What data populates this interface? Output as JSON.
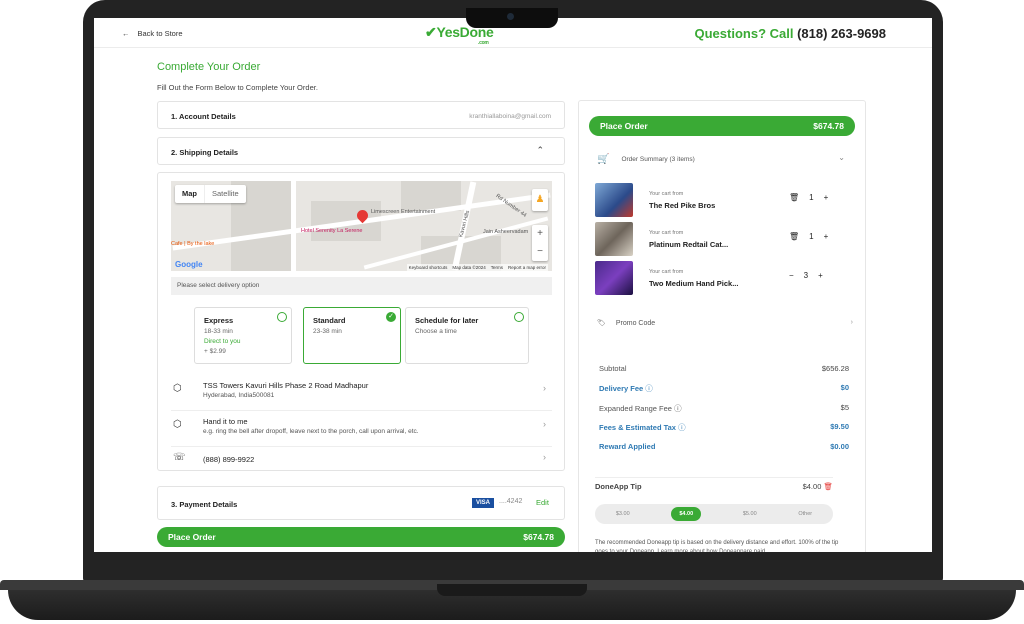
{
  "header": {
    "back_label": "Back to Store",
    "logo_text": "YesDone",
    "logo_suffix": ".com",
    "questions_label": "Questions? Call",
    "phone_number": "(818) 263-9698"
  },
  "page": {
    "title": "Complete Your Order",
    "subtitle": "Fill Out the Form Below to Complete Your Order."
  },
  "account": {
    "label": "1. Account Details",
    "email": "kranthiallaboina@gmail.com"
  },
  "shipping": {
    "label": "2. Shipping Details",
    "map": {
      "tab_map": "Map",
      "tab_satellite": "Satellite",
      "labels": [
        "Hotel Serenity La Serene",
        "Limescreen Entertainment",
        "Jain Asheervadam",
        "Rd Number 44",
        "Kavuri Hills",
        "Cafe | By the lake"
      ],
      "footer": [
        "Keyboard shortcuts",
        "Map data ©2024",
        "Terms",
        "Report a map error"
      ],
      "google": "Google"
    },
    "delivery_prompt": "Please select delivery option",
    "options": [
      {
        "title": "Express",
        "time": "18-33 min",
        "note": "Direct to you",
        "price": "+ $2.99"
      },
      {
        "title": "Standard",
        "time": "23-38 min",
        "note": "",
        "price": ""
      },
      {
        "title": "Schedule for later",
        "time": "Choose a time",
        "note": "",
        "price": ""
      }
    ],
    "address_line1": "TSS Towers Kavuri Hills Phase 2 Road Madhapur",
    "address_line2": "Hyderabad, India500081",
    "handoff_title": "Hand it to me",
    "handoff_hint": "e.g. ring the bell after dropoff, leave next to the porch, call upon arrival, etc.",
    "phone": "(888) 899-9922"
  },
  "payment": {
    "label": "3. Payment Details",
    "card_brand": "VISA",
    "last4": "....4242",
    "edit_label": "Edit"
  },
  "place_order": {
    "label": "Place Order",
    "total": "$674.78"
  },
  "summary": {
    "place_label": "Place Order",
    "place_total": "$674.78",
    "order_summary": "Order Summary (3 items)",
    "items": [
      {
        "from": "Your cart from",
        "name": "The Red Pike Bros",
        "qty": "1"
      },
      {
        "from": "Your cart from",
        "name": "Platinum Redtail Cat...",
        "qty": "1"
      },
      {
        "from": "Your cart from",
        "name": "Two Medium Hand Pick...",
        "qty": "3"
      }
    ],
    "promo_label": "Promo Code",
    "subtotal_label": "Subtotal",
    "subtotal": "$656.28",
    "delivery_fee_label": "Delivery Fee",
    "delivery_fee": "$0",
    "expanded_label": "Expanded Range Fee",
    "expanded_fee": "$5",
    "fees_label": "Fees & Estimated Tax",
    "fees": "$9.50",
    "reward_label": "Reward Applied",
    "reward": "$0.00",
    "tip_label": "DoneApp Tip",
    "tip_value": "$4.00",
    "tip_options": [
      "$3.00",
      "$4.00",
      "$5.00",
      "Other"
    ],
    "tip_note": "The recommended Doneapp tip is based on the delivery distance and effort. 100% of the tip goes to your Doneapp. Learn more about how Doneappare paid"
  },
  "colors": {
    "brand_green": "#3aaa35",
    "accent_blue": "#2f7ab3"
  }
}
